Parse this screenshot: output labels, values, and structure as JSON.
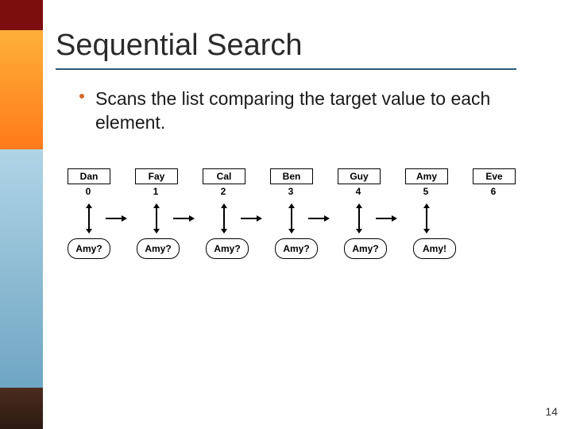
{
  "title": "Sequential Search",
  "bullet": "Scans the list comparing the target value to each element.",
  "cells": [
    {
      "name": "Dan",
      "index": "0"
    },
    {
      "name": "Fay",
      "index": "1"
    },
    {
      "name": "Cal",
      "index": "2"
    },
    {
      "name": "Ben",
      "index": "3"
    },
    {
      "name": "Guy",
      "index": "4"
    },
    {
      "name": "Amy",
      "index": "5"
    },
    {
      "name": "Eve",
      "index": "6"
    }
  ],
  "bubbles": [
    "Amy?",
    "Amy?",
    "Amy?",
    "Amy?",
    "Amy?",
    "Amy!"
  ],
  "page_number": "14"
}
